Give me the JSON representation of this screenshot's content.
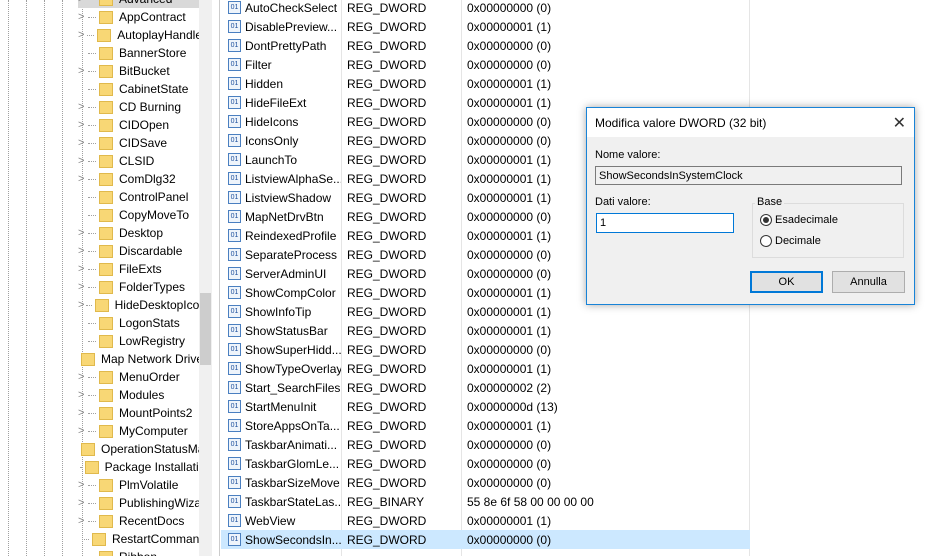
{
  "tree": {
    "items": [
      {
        "label": "Advanced",
        "exp": true,
        "selected": true
      },
      {
        "label": "AppContract",
        "exp": true
      },
      {
        "label": "AutoplayHandlers",
        "exp": true
      },
      {
        "label": "BannerStore",
        "exp": false
      },
      {
        "label": "BitBucket",
        "exp": true
      },
      {
        "label": "CabinetState",
        "exp": false
      },
      {
        "label": "CD Burning",
        "exp": true
      },
      {
        "label": "CIDOpen",
        "exp": true
      },
      {
        "label": "CIDSave",
        "exp": true
      },
      {
        "label": "CLSID",
        "exp": true
      },
      {
        "label": "ComDlg32",
        "exp": true
      },
      {
        "label": "ControlPanel",
        "exp": false
      },
      {
        "label": "CopyMoveTo",
        "exp": false
      },
      {
        "label": "Desktop",
        "exp": true
      },
      {
        "label": "Discardable",
        "exp": true
      },
      {
        "label": "FileExts",
        "exp": true
      },
      {
        "label": "FolderTypes",
        "exp": true
      },
      {
        "label": "HideDesktopIcons",
        "exp": true
      },
      {
        "label": "LogonStats",
        "exp": false
      },
      {
        "label": "LowRegistry",
        "exp": false
      },
      {
        "label": "Map Network Drive MRU",
        "exp": false
      },
      {
        "label": "MenuOrder",
        "exp": true
      },
      {
        "label": "Modules",
        "exp": true
      },
      {
        "label": "MountPoints2",
        "exp": true
      },
      {
        "label": "MyComputer",
        "exp": true
      },
      {
        "label": "OperationStatusManager",
        "exp": false
      },
      {
        "label": "Package Installation",
        "exp": false
      },
      {
        "label": "PlmVolatile",
        "exp": true
      },
      {
        "label": "PublishingWizard",
        "exp": true
      },
      {
        "label": "RecentDocs",
        "exp": true
      },
      {
        "label": "RestartCommands",
        "exp": false
      },
      {
        "label": "Ribbon",
        "exp": false
      }
    ]
  },
  "values": [
    [
      "AutoCheckSelect",
      "REG_DWORD",
      "0x00000000 (0)"
    ],
    [
      "DisablePreview...",
      "REG_DWORD",
      "0x00000001 (1)"
    ],
    [
      "DontPrettyPath",
      "REG_DWORD",
      "0x00000000 (0)"
    ],
    [
      "Filter",
      "REG_DWORD",
      "0x00000000 (0)"
    ],
    [
      "Hidden",
      "REG_DWORD",
      "0x00000001 (1)"
    ],
    [
      "HideFileExt",
      "REG_DWORD",
      "0x00000001 (1)"
    ],
    [
      "HideIcons",
      "REG_DWORD",
      "0x00000000 (0)"
    ],
    [
      "IconsOnly",
      "REG_DWORD",
      "0x00000000 (0)"
    ],
    [
      "LaunchTo",
      "REG_DWORD",
      "0x00000001 (1)"
    ],
    [
      "ListviewAlphaSe...",
      "REG_DWORD",
      "0x00000001 (1)"
    ],
    [
      "ListviewShadow",
      "REG_DWORD",
      "0x00000001 (1)"
    ],
    [
      "MapNetDrvBtn",
      "REG_DWORD",
      "0x00000000 (0)"
    ],
    [
      "ReindexedProfile",
      "REG_DWORD",
      "0x00000001 (1)"
    ],
    [
      "SeparateProcess",
      "REG_DWORD",
      "0x00000000 (0)"
    ],
    [
      "ServerAdminUI",
      "REG_DWORD",
      "0x00000000 (0)"
    ],
    [
      "ShowCompColor",
      "REG_DWORD",
      "0x00000001 (1)"
    ],
    [
      "ShowInfoTip",
      "REG_DWORD",
      "0x00000001 (1)"
    ],
    [
      "ShowStatusBar",
      "REG_DWORD",
      "0x00000001 (1)"
    ],
    [
      "ShowSuperHidd...",
      "REG_DWORD",
      "0x00000000 (0)"
    ],
    [
      "ShowTypeOverlay",
      "REG_DWORD",
      "0x00000001 (1)"
    ],
    [
      "Start_SearchFiles",
      "REG_DWORD",
      "0x00000002 (2)"
    ],
    [
      "StartMenuInit",
      "REG_DWORD",
      "0x0000000d (13)"
    ],
    [
      "StoreAppsOnTa...",
      "REG_DWORD",
      "0x00000001 (1)"
    ],
    [
      "TaskbarAnimati...",
      "REG_DWORD",
      "0x00000000 (0)"
    ],
    [
      "TaskbarGlomLe...",
      "REG_DWORD",
      "0x00000000 (0)"
    ],
    [
      "TaskbarSizeMove",
      "REG_DWORD",
      "0x00000000 (0)"
    ],
    [
      "TaskbarStateLas...",
      "REG_BINARY",
      "55 8e 6f 58 00 00 00 00"
    ],
    [
      "WebView",
      "REG_DWORD",
      "0x00000001 (1)"
    ],
    [
      "ShowSecondsIn...",
      "REG_DWORD",
      "0x00000000 (0)"
    ]
  ],
  "dialog": {
    "title": "Modifica valore DWORD (32 bit)",
    "name_label": "Nome valore:",
    "name_value": "ShowSecondsInSystemClock",
    "data_label": "Dati valore:",
    "data_value": "1",
    "base_label": "Base",
    "hex_label": "Esadecimale",
    "dec_label": "Decimale",
    "ok": "OK",
    "cancel": "Annulla",
    "close": "✕"
  }
}
